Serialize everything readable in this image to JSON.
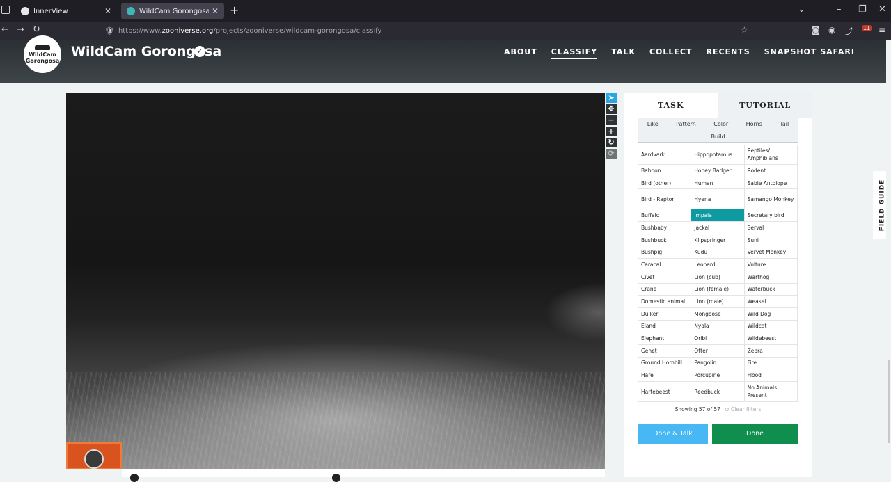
{
  "browser": {
    "tabs": [
      {
        "title": "InnerView",
        "active": false,
        "favicon_color": "#e8e8ea"
      },
      {
        "title": "WildCam Gorongosa » Classify",
        "active": true,
        "favicon_color": "#3fb6b6"
      }
    ],
    "url_scheme": "https://www.",
    "url_domain": "zooniverse.org",
    "url_path": "/projects/zooniverse/wildcam-gorongosa/classify",
    "extension_badge": "11"
  },
  "header": {
    "logo_line1": "WildCam",
    "logo_line2": "Gorongosa",
    "project_title": "WildCam Gorongosa",
    "nav": [
      "ABOUT",
      "CLASSIFY",
      "TALK",
      "COLLECT",
      "RECENTS",
      "SNAPSHOT SAFARI"
    ],
    "active_nav": "CLASSIFY"
  },
  "panel": {
    "tabs": [
      "TASK",
      "TUTORIAL"
    ],
    "active_tab": "TASK",
    "filters": [
      "Like",
      "Pattern",
      "Color",
      "Horns",
      "Tail"
    ],
    "filters_row2": "Build",
    "species_rows": [
      [
        "Aardvark",
        "Hippopotamus",
        "Reptiles/ Amphibians"
      ],
      [
        "Baboon",
        "Honey Badger",
        "Rodent"
      ],
      [
        "Bird (other)",
        "Human",
        "Sable Antolope"
      ],
      [
        "Bird - Raptor",
        "Hyena",
        "Samango Monkey"
      ],
      [
        "Buffalo",
        "Impala",
        "Secretary bird"
      ],
      [
        "Bushbaby",
        "Jackal",
        "Serval"
      ],
      [
        "Bushbuck",
        "Klipspringer",
        "Suni"
      ],
      [
        "Bushpig",
        "Kudu",
        "Vervet Monkey"
      ],
      [
        "Caracal",
        "Leopard",
        "Vulture"
      ],
      [
        "Civet",
        "Lion (cub)",
        "Warthog"
      ],
      [
        "Crane",
        "Lion (female)",
        "Waterbuck"
      ],
      [
        "Domestic animal",
        "Lion (male)",
        "Weasel"
      ],
      [
        "Duiker",
        "Mongoose",
        "Wild Dog"
      ],
      [
        "Eland",
        "Nyala",
        "Wildcat"
      ],
      [
        "Elephant",
        "Oribi",
        "Wildebeest"
      ],
      [
        "Genet",
        "Otter",
        "Zebra"
      ],
      [
        "Ground Hornbill",
        "Pangolin",
        "Fire"
      ],
      [
        "Hare",
        "Porcupine",
        "Flood"
      ],
      [
        "Hartebeest",
        "Reedbuck",
        "No Animals Present"
      ]
    ],
    "selected_species": "Impala",
    "showing": "Showing 57 of 57",
    "clear_filters": "⊘ Clear filters",
    "done_talk": "Done & Talk",
    "done": "Done"
  },
  "field_guide": "FIELD GUIDE",
  "colors": {
    "selected": "#0d9aa0",
    "done": "#0f8e4d",
    "done_talk": "#48b8f4"
  }
}
